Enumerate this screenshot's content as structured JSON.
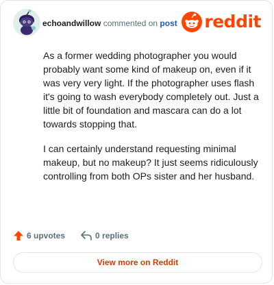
{
  "comment": {
    "username": "echoandwillow",
    "commented_on": "commented on",
    "post_link": "post",
    "brand": "reddit",
    "paragraphs": [
      "As a former wedding photographer you would probably want some kind of makeup on, even if it was very very light. If the photographer uses flash it's going to wash everybody completely out. Just a little bit of foundation and mascara can do a lot towards stopping that.",
      "I can certainly understand requesting minimal makeup, but no makeup? It just seems ridiculously controlling from both OPs sister and her husband."
    ],
    "upvotes_label": "6 upvotes",
    "replies_label": "0 replies",
    "view_more_label": "View more on Reddit"
  },
  "colors": {
    "brand_orange": "#ff4500",
    "link_blue": "#2156b8",
    "muted_text": "#576f76",
    "button_text": "#d93a00"
  },
  "icons": {
    "avatar": "snoo-avatar",
    "logo": "reddit-snoo-logo-icon",
    "upvote": "upvote-arrow-icon",
    "reply": "reply-arrow-icon"
  }
}
